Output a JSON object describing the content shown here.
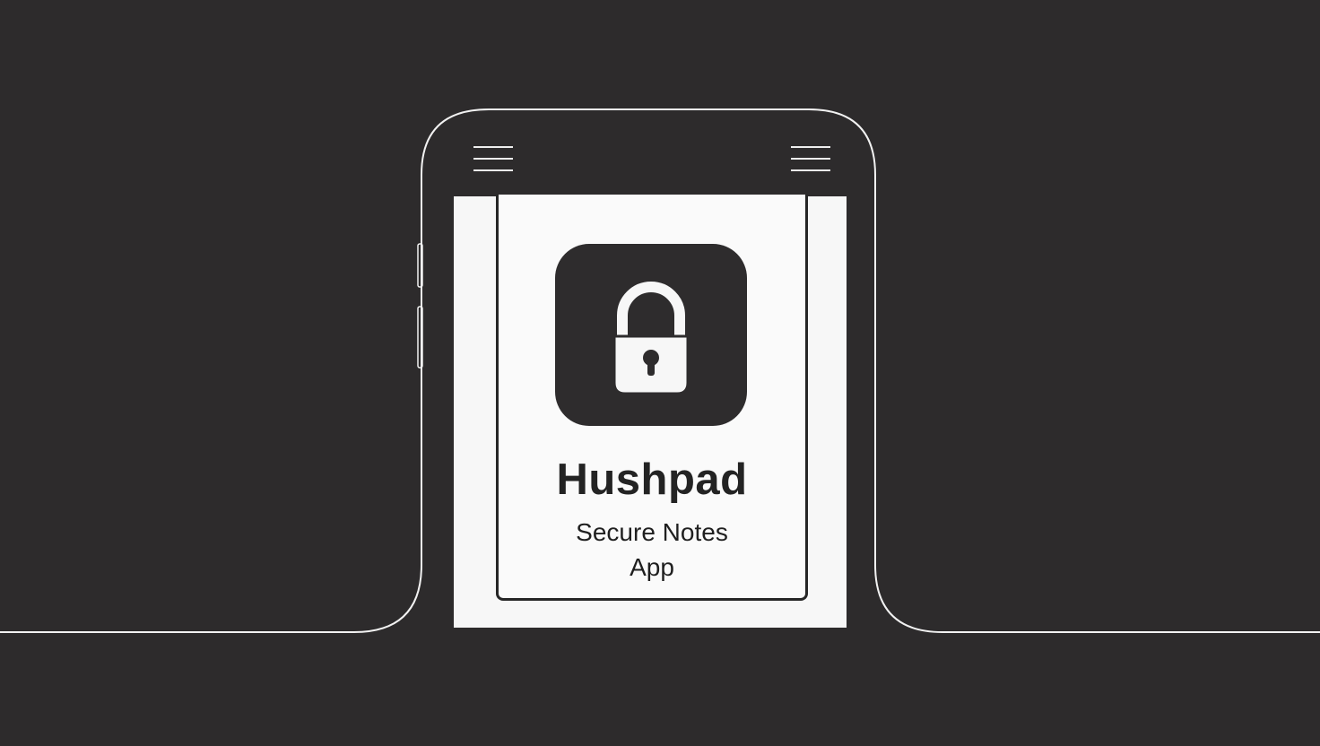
{
  "app": {
    "name": "Hushpad",
    "tagline": "Secure Notes App"
  },
  "icons": {
    "menu_left": "hamburger-menu-icon",
    "menu_right": "hamburger-menu-icon",
    "app_icon": "padlock-icon"
  },
  "colors": {
    "background": "#2d2b2c",
    "outline": "#f2f2f2",
    "screen": "#f7f7f7",
    "icon_tile": "#2e2c2d",
    "text": "#232323"
  }
}
